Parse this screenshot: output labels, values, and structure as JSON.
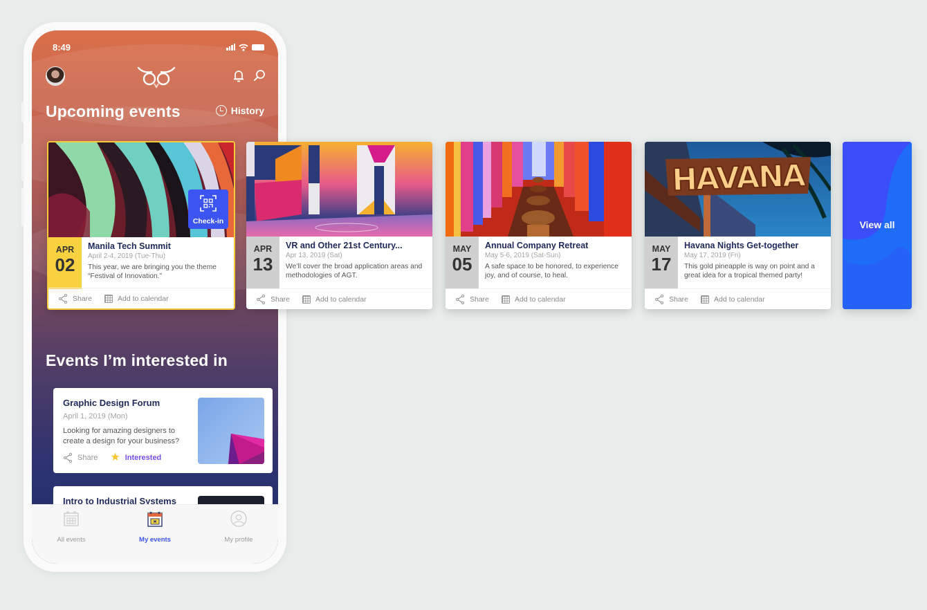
{
  "status_bar": {
    "time": "8:49"
  },
  "header": {
    "avatar": "user-avatar",
    "logo": "owl-logo",
    "icons": [
      "bell-icon",
      "search-icon"
    ]
  },
  "upcoming": {
    "title": "Upcoming events",
    "history_label": "History",
    "checkin_label": "Check-in",
    "share_label": "Share",
    "calendar_label": "Add to calendar",
    "view_all_label": "View all",
    "events": [
      {
        "month": "APR",
        "day": "02",
        "title": "Manila Tech Summit",
        "date": "April 2-4, 2019 (Tue-Thu)",
        "desc": "This year, we are bringing you the theme “Festival of Innovation.”",
        "active": true
      },
      {
        "month": "APR",
        "day": "13",
        "title": "VR and Other 21st Century...",
        "date": "Apr 13, 2019 (Sat)",
        "desc": "We’ll cover the broad application areas and methodologies of AGT."
      },
      {
        "month": "MAY",
        "day": "05",
        "title": "Annual Company Retreat",
        "date": "May 5-6, 2019 (Sat-Sun)",
        "desc": "A safe space to be honored, to experience joy, and of course, to heal."
      },
      {
        "month": "MAY",
        "day": "17",
        "title": "Havana Nights Get-together",
        "date": "May 17, 2019 (Fri)",
        "desc": "This gold pineapple is way on point and a great idea for a tropical themed party!"
      }
    ]
  },
  "interested": {
    "title": "Events I’m interested in",
    "share_label": "Share",
    "interested_label": "Interested",
    "events": [
      {
        "title": "Graphic Design Forum",
        "date": "April 1, 2019 (Mon)",
        "desc": "Looking for amazing designers to create a design for your business?"
      },
      {
        "title": "Intro to Industrial Systems"
      }
    ]
  },
  "tabbar": {
    "tabs": [
      {
        "label": "All events",
        "icon": "calendar-icon"
      },
      {
        "label": "My events",
        "icon": "my-events-icon",
        "active": true
      },
      {
        "label": "My profile",
        "icon": "profile-icon"
      }
    ]
  },
  "colors": {
    "accent": "#3b54f2",
    "highlight": "#f8d140",
    "title_navy": "#1f2a5a",
    "interested_purple": "#7b4df0"
  }
}
